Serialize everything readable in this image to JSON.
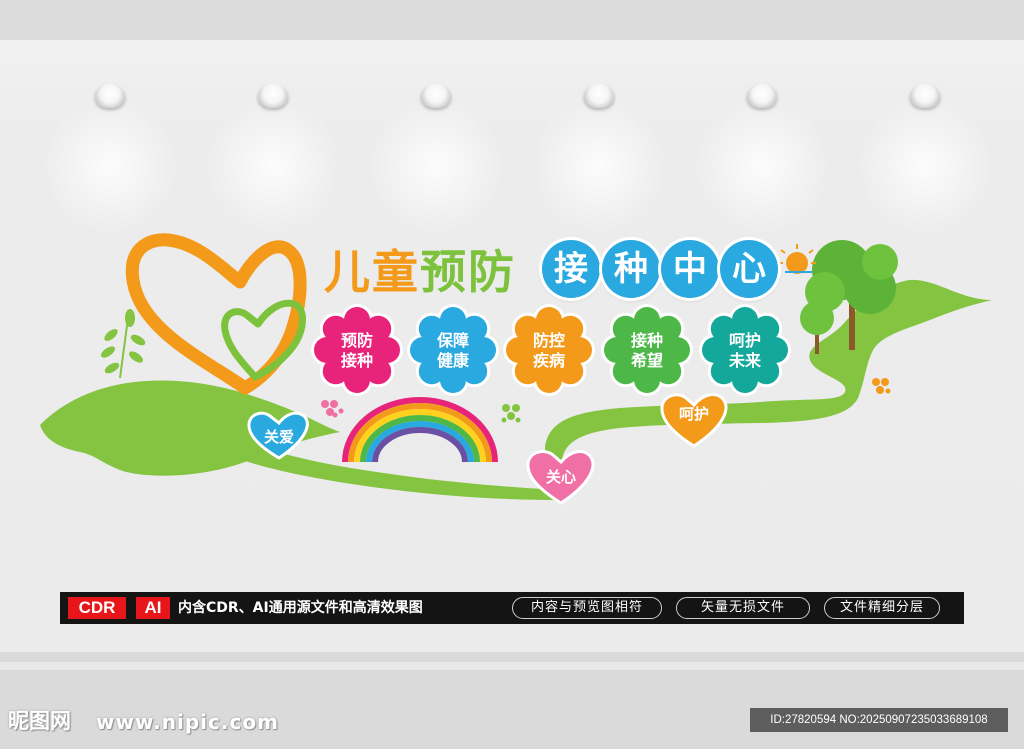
{
  "title": {
    "part1": [
      "儿",
      "童"
    ],
    "part2": [
      "预",
      "防"
    ],
    "circles": [
      "接",
      "种",
      "中",
      "心"
    ]
  },
  "flowers": [
    {
      "line1": "预防",
      "line2": "接种",
      "color": "#e8237a"
    },
    {
      "line1": "保障",
      "line2": "健康",
      "color": "#2aa8e0"
    },
    {
      "line1": "防控",
      "line2": "疾病",
      "color": "#f39a1b"
    },
    {
      "line1": "接种",
      "line2": "希望",
      "color": "#4db848"
    },
    {
      "line1": "呵护",
      "line2": "未来",
      "color": "#14a89a"
    }
  ],
  "hearts": [
    {
      "label": "关爱",
      "color": "#2aa8e0"
    },
    {
      "label": "关心",
      "color": "#f06fa4"
    },
    {
      "label": "呵护",
      "color": "#f39a1b"
    }
  ],
  "bar": {
    "tag_cdr": "CDR",
    "tag_ai": "AI",
    "description": "内含CDR、AI通用源文件和高清效果图",
    "pills": [
      "内容与预览图相符",
      "矢量无损文件",
      "文件精细分层"
    ]
  },
  "watermark": {
    "logo": "昵图网",
    "url": "www.nipic.com",
    "id": "ID:27820594 NO:20250907235033689108"
  },
  "colors": {
    "orange": "#f39a1b",
    "green": "#7dc23d",
    "blue": "#2aa8e0",
    "bar": "#141414",
    "tag_red": "#e6161a"
  }
}
